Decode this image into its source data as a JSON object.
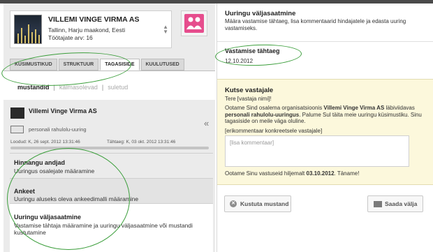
{
  "company": {
    "name": "VILLEMI VINGE VIRMA AS",
    "location": "Tallinn, Harju maakond, Eesti",
    "employees": "Töötajate arv: 16"
  },
  "tabs": [
    {
      "label": "KÜSIMUSTIKUD"
    },
    {
      "label": "STRUKTUUR"
    },
    {
      "label": "TAGASISIDE"
    },
    {
      "label": "KUULUTUSED"
    }
  ],
  "subtabs": {
    "draft": "mustandid",
    "pending": "käimasolevad",
    "closed": "suletud",
    "separator": "|"
  },
  "survey": {
    "title": "Villemi Vinge Virma AS",
    "type": "personali rahulolu-uuring",
    "created": "Loodud: K, 26 sept. 2012 13:31:46",
    "deadline": "Tähtaeg: K, 03 okt. 2012 13:31:46",
    "collapse_icon": "«"
  },
  "steps": [
    {
      "title": "Hinnangu andjad",
      "desc": "Uuringus osalejate määramine"
    },
    {
      "title": "Ankeet",
      "desc": "Uuringu aluseks oleva ankeedimalli määramine"
    },
    {
      "title": "Uuringu väljasaatmine",
      "desc": "Vastamise tähtaja määramine ja uuringu väljasaatmine või mustandi kustutamine"
    }
  ],
  "detail": {
    "title": "Uuringu väljasaatmine",
    "desc": "Määra vastamise tähtaeg, lisa kommentaarid hindajatele ja edasta uuring vastamiseks.",
    "deadline_label": "Vastamise tähtaeg",
    "deadline_value": "12.10.2012"
  },
  "invite": {
    "title": "Kutse vastajale",
    "greeting": "Tere [vastaja nimi]!",
    "body_1": "Ootame Sind osalema organisatsioonis ",
    "body_company": "Villemi Vinge Virma AS",
    "body_2": " läbiviidavas ",
    "body_survey": "personali rahulolu-uuringus",
    "body_3": ". Palume Sul täita meie uuringu küsimustiku. Sinu tagasiside on meile väga oluline.",
    "note": "[erikommentaar konkreetsele vastajale]",
    "comment_placeholder": "[lisa kommentaar]",
    "footer_1": "Ootame Sinu vastuseid hiljemalt ",
    "footer_date": "03.10.2012",
    "footer_2": ". Täname!"
  },
  "buttons": {
    "delete": "Kustuta mustand",
    "send": "Saada välja"
  },
  "icons": {
    "people": "people-icon",
    "delete": "x-circle-icon",
    "send": "envelope-icon"
  },
  "colors": {
    "accent_pink": "#e64d8d",
    "invite_bg": "#fcf8dc",
    "annotation_green": "#3b9e3b"
  }
}
